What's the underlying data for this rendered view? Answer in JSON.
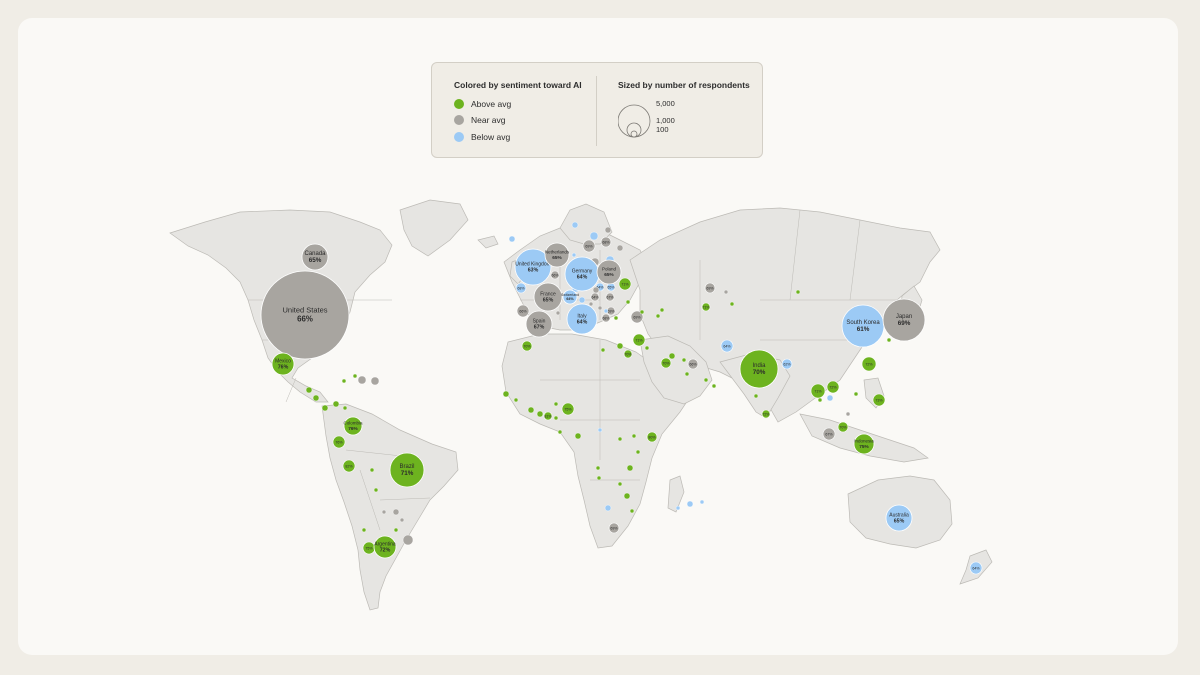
{
  "legend": {
    "color_title": "Colored by sentiment toward AI",
    "size_title": "Sized by number of respondents",
    "categories": [
      {
        "key": "above",
        "label": "Above avg",
        "color": "#6db31f"
      },
      {
        "key": "near",
        "label": "Near avg",
        "color": "#a8a5a0"
      },
      {
        "key": "below",
        "label": "Below avg",
        "color": "#9ccaf5"
      }
    ],
    "size_labels": [
      "5,000",
      "1,000",
      "100"
    ]
  },
  "colors": {
    "above": "#6db31f",
    "near": "#a8a5a0",
    "below": "#9ccaf5",
    "land": "#e6e5e2",
    "border": "#bcbab5",
    "label_text": "#2b2b2b"
  },
  "countries": [
    {
      "name": "United States",
      "value": "66%",
      "cat": "near"
    },
    {
      "name": "Canada",
      "value": "65%",
      "cat": "near"
    },
    {
      "name": "Mexico",
      "value": "76%",
      "cat": "above"
    },
    {
      "name": "Colombia",
      "value": "76%",
      "cat": "above"
    },
    {
      "name": "Brazil",
      "value": "71%",
      "cat": "above"
    },
    {
      "name": "Argentina",
      "value": "72%",
      "cat": "above"
    },
    {
      "name": "United Kingdom",
      "value": "63%",
      "cat": "below"
    },
    {
      "name": "Netherlands",
      "value": "65%",
      "cat": "near"
    },
    {
      "name": "Germany",
      "value": "64%",
      "cat": "below"
    },
    {
      "name": "France",
      "value": "65%",
      "cat": "near"
    },
    {
      "name": "Switzerland",
      "value": "64%",
      "cat": "below"
    },
    {
      "name": "Spain",
      "value": "67%",
      "cat": "near"
    },
    {
      "name": "Italy",
      "value": "64%",
      "cat": "below"
    },
    {
      "name": "Poland",
      "value": "65%",
      "cat": "near"
    },
    {
      "name": "India",
      "value": "70%",
      "cat": "above"
    },
    {
      "name": "South Korea",
      "value": "61%",
      "cat": "below"
    },
    {
      "name": "Japan",
      "value": "69%",
      "cat": "near"
    },
    {
      "name": "Indonesia",
      "value": "75%",
      "cat": "above"
    },
    {
      "name": "Australia",
      "value": "65%",
      "cat": "below"
    }
  ],
  "small_bubbles": [
    {
      "value": "76%",
      "cat": "above"
    },
    {
      "value": "82%",
      "cat": "above"
    },
    {
      "value": "75%",
      "cat": "above"
    },
    {
      "value": "66%",
      "cat": "near"
    },
    {
      "value": "68%",
      "cat": "below"
    },
    {
      "value": "70%",
      "cat": "above"
    },
    {
      "value": "69%",
      "cat": "near"
    },
    {
      "value": "68%",
      "cat": "near"
    },
    {
      "value": "62%",
      "cat": "below"
    },
    {
      "value": "66%",
      "cat": "near"
    },
    {
      "value": "64%",
      "cat": "below"
    },
    {
      "value": "67%",
      "cat": "near"
    },
    {
      "value": "64%",
      "cat": "near"
    },
    {
      "value": "69%",
      "cat": "near"
    },
    {
      "value": "71%",
      "cat": "above"
    },
    {
      "value": "69%",
      "cat": "near"
    },
    {
      "value": "68%",
      "cat": "near"
    },
    {
      "value": "65%",
      "cat": "below"
    },
    {
      "value": "69%",
      "cat": "near"
    },
    {
      "value": "71%",
      "cat": "above"
    },
    {
      "value": "71%",
      "cat": "above"
    },
    {
      "value": "72%",
      "cat": "above"
    },
    {
      "value": "70%",
      "cat": "above"
    },
    {
      "value": "66%",
      "cat": "near"
    },
    {
      "value": "64%",
      "cat": "below"
    },
    {
      "value": "62%",
      "cat": "below"
    },
    {
      "value": "72%",
      "cat": "above"
    },
    {
      "value": "71%",
      "cat": "above"
    },
    {
      "value": "73%",
      "cat": "above"
    },
    {
      "value": "72%",
      "cat": "above"
    },
    {
      "value": "70%",
      "cat": "above"
    },
    {
      "value": "67%",
      "cat": "near"
    },
    {
      "value": "70%",
      "cat": "above"
    },
    {
      "value": "75%",
      "cat": "above"
    },
    {
      "value": "80%",
      "cat": "above"
    },
    {
      "value": "81%",
      "cat": "above"
    },
    {
      "value": "69%",
      "cat": "near"
    },
    {
      "value": "64%",
      "cat": "below"
    },
    {
      "value": "65%",
      "cat": "near"
    }
  ]
}
